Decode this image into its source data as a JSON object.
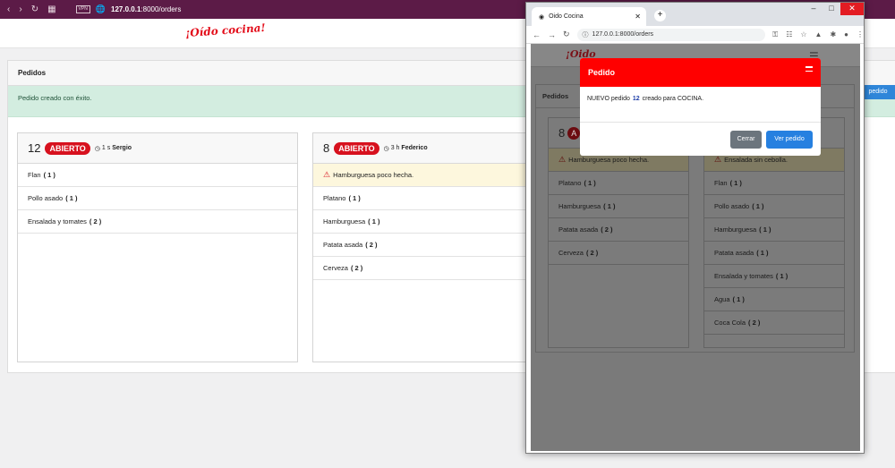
{
  "main_browser": {
    "url_host": "127.0.0.1",
    "url_path": ":8000/orders",
    "vpn_label": "VPN"
  },
  "app": {
    "logo": "¡Oído cocina!",
    "panel_title": "Pedidos",
    "alert": "Pedido creado con éxito.",
    "new_button": "pedido"
  },
  "orders": [
    {
      "number": "12",
      "status": "ABIERTO",
      "time": "1 s",
      "user": "Sergio",
      "note": "",
      "items": [
        {
          "name": "Flan",
          "qty": "( 1 )"
        },
        {
          "name": "Pollo asado",
          "qty": "( 1 )"
        },
        {
          "name": "Ensalada y tomates",
          "qty": "( 2 )"
        }
      ]
    },
    {
      "number": "8",
      "status": "ABIERTO",
      "time": "3 h",
      "user": "Federico",
      "note": "Hamburguesa poco hecha.",
      "items": [
        {
          "name": "Platano",
          "qty": "( 1 )"
        },
        {
          "name": "Hamburguesa",
          "qty": "( 1 )"
        },
        {
          "name": "Patata asada",
          "qty": "( 2 )"
        },
        {
          "name": "Cerveza",
          "qty": "( 2 )"
        }
      ]
    }
  ],
  "popup": {
    "tab_title": "Oido Cocina",
    "url": "127.0.0.1:8000/orders",
    "logo": "¡Oido",
    "panel_title": "Pedidos",
    "card_left": {
      "number": "8",
      "badge": "A",
      "note": "Hamburguesa poco hecha.",
      "items": [
        {
          "name": "Platano",
          "qty": "( 1 )"
        },
        {
          "name": "Hamburguesa",
          "qty": "( 1 )"
        },
        {
          "name": "Patata asada",
          "qty": "( 2 )"
        },
        {
          "name": "Cerveza",
          "qty": "( 2 )"
        }
      ]
    },
    "card_right": {
      "note": "Ensalada sin cebolla.",
      "items": [
        {
          "name": "Flan",
          "qty": "( 1 )"
        },
        {
          "name": "Pollo asado",
          "qty": "( 1 )"
        },
        {
          "name": "Hamburguesa",
          "qty": "( 1 )"
        },
        {
          "name": "Patata asada",
          "qty": "( 1 )"
        },
        {
          "name": "Ensalada y tomates",
          "qty": "( 1 )"
        },
        {
          "name": "Agua",
          "qty": "( 1 )"
        },
        {
          "name": "Coca Cola",
          "qty": "( 2 )"
        }
      ]
    },
    "modal": {
      "title": "Pedido",
      "text_before": "NUEVO pedido",
      "order_number": "12",
      "text_after": "creado para COCINA.",
      "close_label": "Cerrar",
      "view_label": "Ver pedido"
    }
  },
  "colors": {
    "brand_red": "#e30d1a",
    "titlebar": "#5c1b47",
    "primary": "#2680e0"
  }
}
